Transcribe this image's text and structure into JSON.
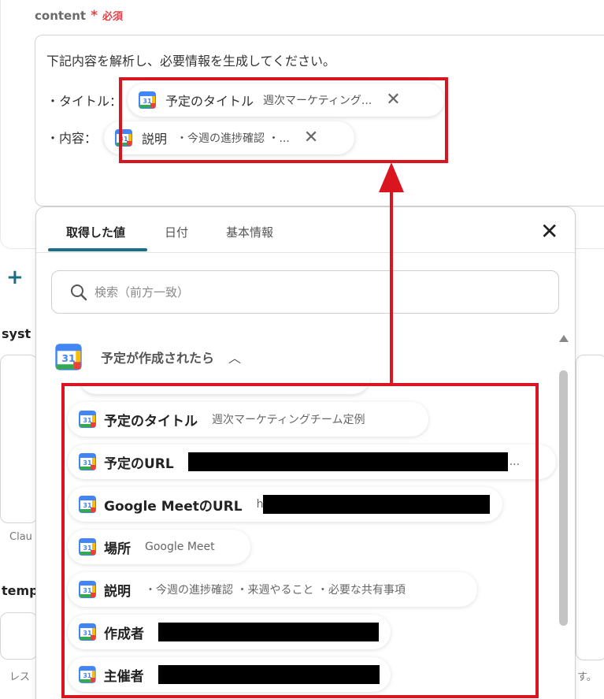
{
  "field": {
    "name": "content",
    "star": "*",
    "required": "必須"
  },
  "textarea": {
    "line1": "下記内容を解析し、必要情報を生成してください。",
    "label_title": "・タイトル：",
    "label_content": "・内容："
  },
  "pills": [
    {
      "name": "予定のタイトル",
      "value": "週次マーケティング..."
    },
    {
      "name": "説明",
      "value": "・今週の進捗確認 ・..."
    }
  ],
  "left_fragments": {
    "plus": "+",
    "syst": "syst",
    "clau": "Clau",
    "temp": "temp",
    "res": "レス",
    "su": "す。"
  },
  "popup": {
    "tabs": [
      {
        "label": "取得した値",
        "active": true
      },
      {
        "label": "日付",
        "active": false
      },
      {
        "label": "基本情報",
        "active": false
      }
    ],
    "close": "×",
    "search_placeholder": "検索（前方一致）",
    "section_title": "予定が作成されたら",
    "icon_day": "31",
    "items": [
      {
        "name": "予定のタイトル",
        "value": "週次マーケティングチーム定例",
        "redacted": false
      },
      {
        "name": "予定のURL",
        "value": "",
        "trail": "...",
        "redacted": true
      },
      {
        "name": "Google MeetのURL",
        "value": "h",
        "redacted": true
      },
      {
        "name": "場所",
        "value": "Google Meet",
        "redacted": false
      },
      {
        "name": "説明",
        "value": "・今週の進捗確認 ・来週やること ・必要な共有事項",
        "redacted": false
      },
      {
        "name": "作成者",
        "value": "",
        "redacted": true
      },
      {
        "name": "主催者",
        "value": "",
        "redacted": true
      }
    ]
  },
  "colors": {
    "accent": "#1a6f88",
    "annotation_red": "#d9161f",
    "required_red": "#e5404a"
  }
}
